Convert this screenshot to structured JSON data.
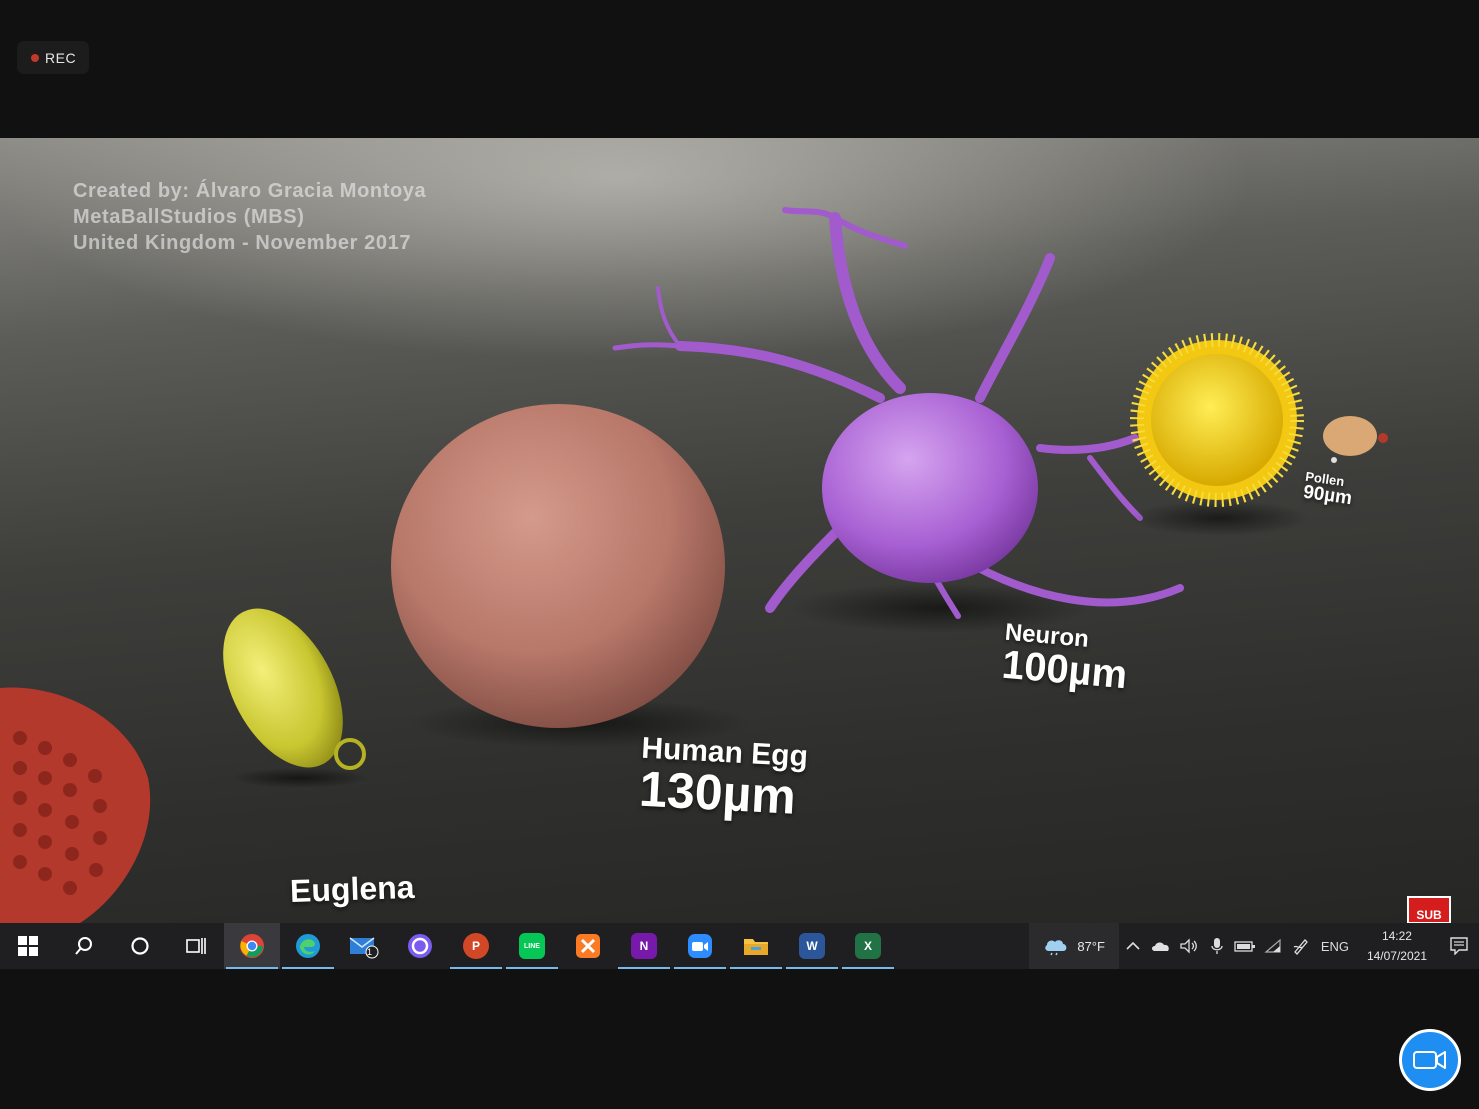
{
  "recording": {
    "label": "REC"
  },
  "video": {
    "credits": [
      "Created by: Álvaro Gracia Montoya",
      "MetaBallStudios (MBS)",
      "United Kingdom - November 2017"
    ],
    "labels": {
      "euglena": {
        "name": "Euglena"
      },
      "human_egg": {
        "name": "Human Egg",
        "size": "130µm"
      },
      "neuron": {
        "name": "Neuron",
        "size": "100µm"
      },
      "pollen": {
        "name": "Pollen",
        "size": "90µm"
      }
    },
    "sub_badge": "SUB"
  },
  "taskbar": {
    "apps": [
      {
        "name": "chrome",
        "color": "#db4437"
      },
      {
        "name": "edge",
        "color": "#1f9cd8"
      },
      {
        "name": "mail",
        "badge": "1"
      },
      {
        "name": "cortana-app",
        "color": "#7c5cf0"
      },
      {
        "name": "powerpoint",
        "letter": "P",
        "color": "#d24726"
      },
      {
        "name": "line",
        "letter": "LINE",
        "color": "#06c755"
      },
      {
        "name": "xampp",
        "color": "#fb7a24"
      },
      {
        "name": "onenote",
        "letter": "N",
        "color": "#7719aa"
      },
      {
        "name": "zoom",
        "color": "#2d8cff"
      },
      {
        "name": "file-explorer",
        "color": "#f5c242"
      },
      {
        "name": "word",
        "letter": "W",
        "color": "#2b579a"
      },
      {
        "name": "excel",
        "letter": "X",
        "color": "#217346"
      }
    ],
    "weather": {
      "temp": "87°F"
    },
    "language": "ENG",
    "time": "14:22",
    "date": "14/07/2021"
  }
}
